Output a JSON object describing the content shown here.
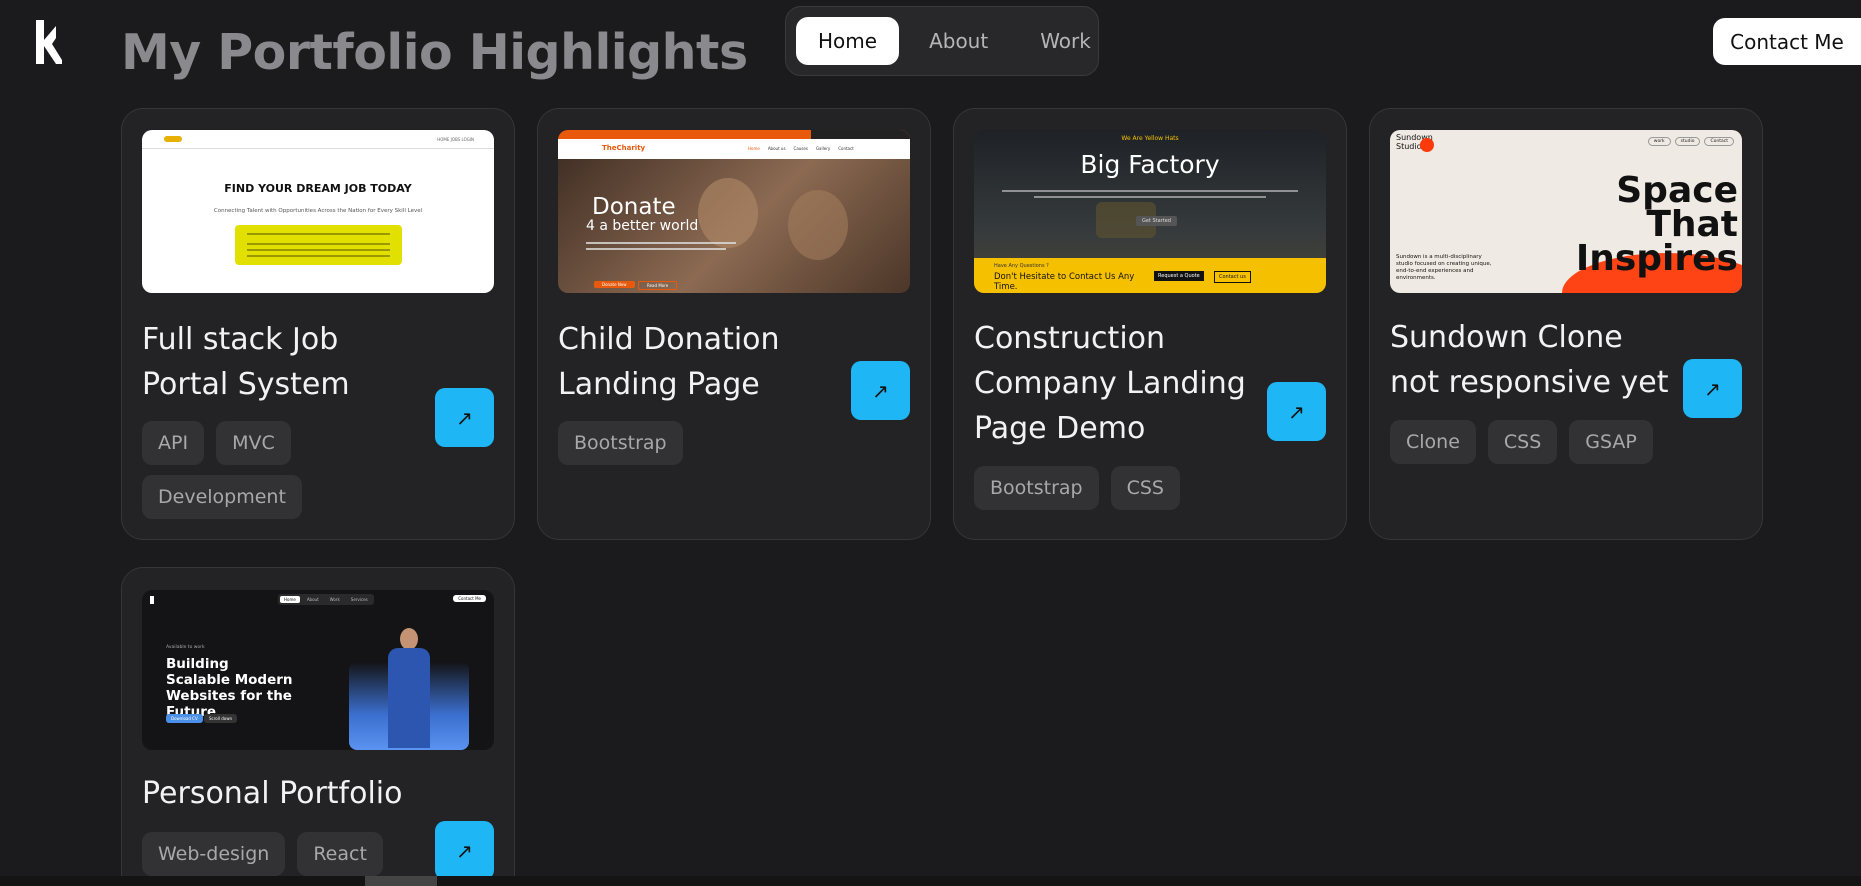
{
  "header": {
    "title": "My Portfolio Highlights",
    "logo_icon": "brand-logo-icon"
  },
  "nav": {
    "items": [
      {
        "label": "Home",
        "active": true
      },
      {
        "label": "About",
        "active": false
      },
      {
        "label": "Work",
        "active": false
      }
    ]
  },
  "contact": {
    "label": "Contact Me"
  },
  "accent_color": "#1fb6f5",
  "projects": [
    {
      "title": "Full stack Job Portal System",
      "tags": [
        "API",
        "MVC",
        "Development"
      ],
      "thumb": {
        "nav": "HOME JOBS LOGIN",
        "heading": "FIND YOUR DREAM JOB TODAY",
        "sub": "Connecting Talent with Opportunities Across the Nation for Every Skill Level"
      }
    },
    {
      "title": "Child Donation Landing Page",
      "tags": [
        "Bootstrap"
      ],
      "thumb": {
        "brand": "TheCharity",
        "nav": [
          "Home",
          "About us",
          "Causes",
          "Gallery",
          "Contact"
        ],
        "heading": "Donate",
        "sub": "4 a better world",
        "btn1": "Donate Now",
        "btn2": "Read More"
      }
    },
    {
      "title": "Construction Company Landing Page Demo",
      "tags": [
        "Bootstrap",
        "CSS"
      ],
      "thumb": {
        "kicker": "We Are Yellow Hats",
        "heading": "Big Factory",
        "btn": "Get Started",
        "question": "Have Any Questions ?",
        "cta": "Don't Hesitate to Contact Us Any Time.",
        "btn1": "Request a Quote",
        "btn2": "Contact us"
      }
    },
    {
      "title": "Sundown Clone not responsive yet",
      "tags": [
        "Clone",
        "CSS",
        "GSAP"
      ],
      "thumb": {
        "brand": "Sundown Studio",
        "nav": [
          "work",
          "studio",
          "Contact"
        ],
        "heading1": "Space",
        "heading2": "That",
        "heading3": "Inspires",
        "desc": "Sundown is a multi-disciplinary studio focused on creating unique, end-to-end experiences and environments."
      }
    },
    {
      "title": "Personal Portfolio",
      "tags": [
        "Web-design",
        "React"
      ],
      "thumb": {
        "nav": [
          "Home",
          "About",
          "Work",
          "Services"
        ],
        "contact": "Contact Me",
        "available": "Available to work",
        "heading": "Building Scalable Modern Websites for the Future",
        "btn1": "Download CV",
        "btn2": "Scroll down"
      }
    }
  ]
}
